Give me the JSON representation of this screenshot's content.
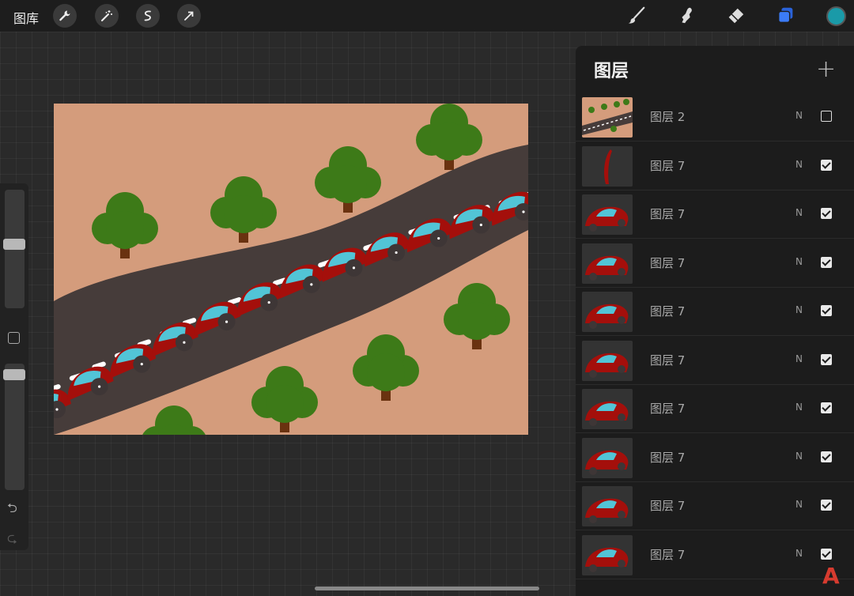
{
  "topbar": {
    "gallery_label": "图库",
    "tools_left": [
      "wrench-icon",
      "magic-wand-icon",
      "selection-icon",
      "transform-arrow-icon"
    ],
    "tools_right": [
      "brush-icon",
      "smudge-icon",
      "eraser-icon",
      "layers-icon"
    ],
    "active_color": "#1a9aa8",
    "layers_accent": "#3478f6"
  },
  "layers": {
    "title": "图层",
    "add_label": "+",
    "items": [
      {
        "name": "图层 2",
        "blend": "N",
        "visible": false
      },
      {
        "name": "图层 7",
        "blend": "N",
        "visible": true
      },
      {
        "name": "图层 7",
        "blend": "N",
        "visible": true
      },
      {
        "name": "图层 7",
        "blend": "N",
        "visible": true
      },
      {
        "name": "图层 7",
        "blend": "N",
        "visible": true
      },
      {
        "name": "图层 7",
        "blend": "N",
        "visible": true
      },
      {
        "name": "图层 7",
        "blend": "N",
        "visible": true
      },
      {
        "name": "图层 7",
        "blend": "N",
        "visible": true
      },
      {
        "name": "图层 7",
        "blend": "N",
        "visible": true
      },
      {
        "name": "图层 7",
        "blend": "N",
        "visible": true
      }
    ]
  },
  "sidebar": {
    "brush_size_level": 0.55,
    "opacity_level": 0.95,
    "undo_icon": "undo-icon",
    "redo_icon": "redo-icon"
  },
  "watermark": "A",
  "colors": {
    "canvas_bg": "#d49c7c",
    "road": "#463c3a",
    "car_body": "#a40f0b",
    "car_window": "#52c4d6",
    "tree_leaf": "#3d7a18",
    "tree_trunk": "#6a3210"
  }
}
